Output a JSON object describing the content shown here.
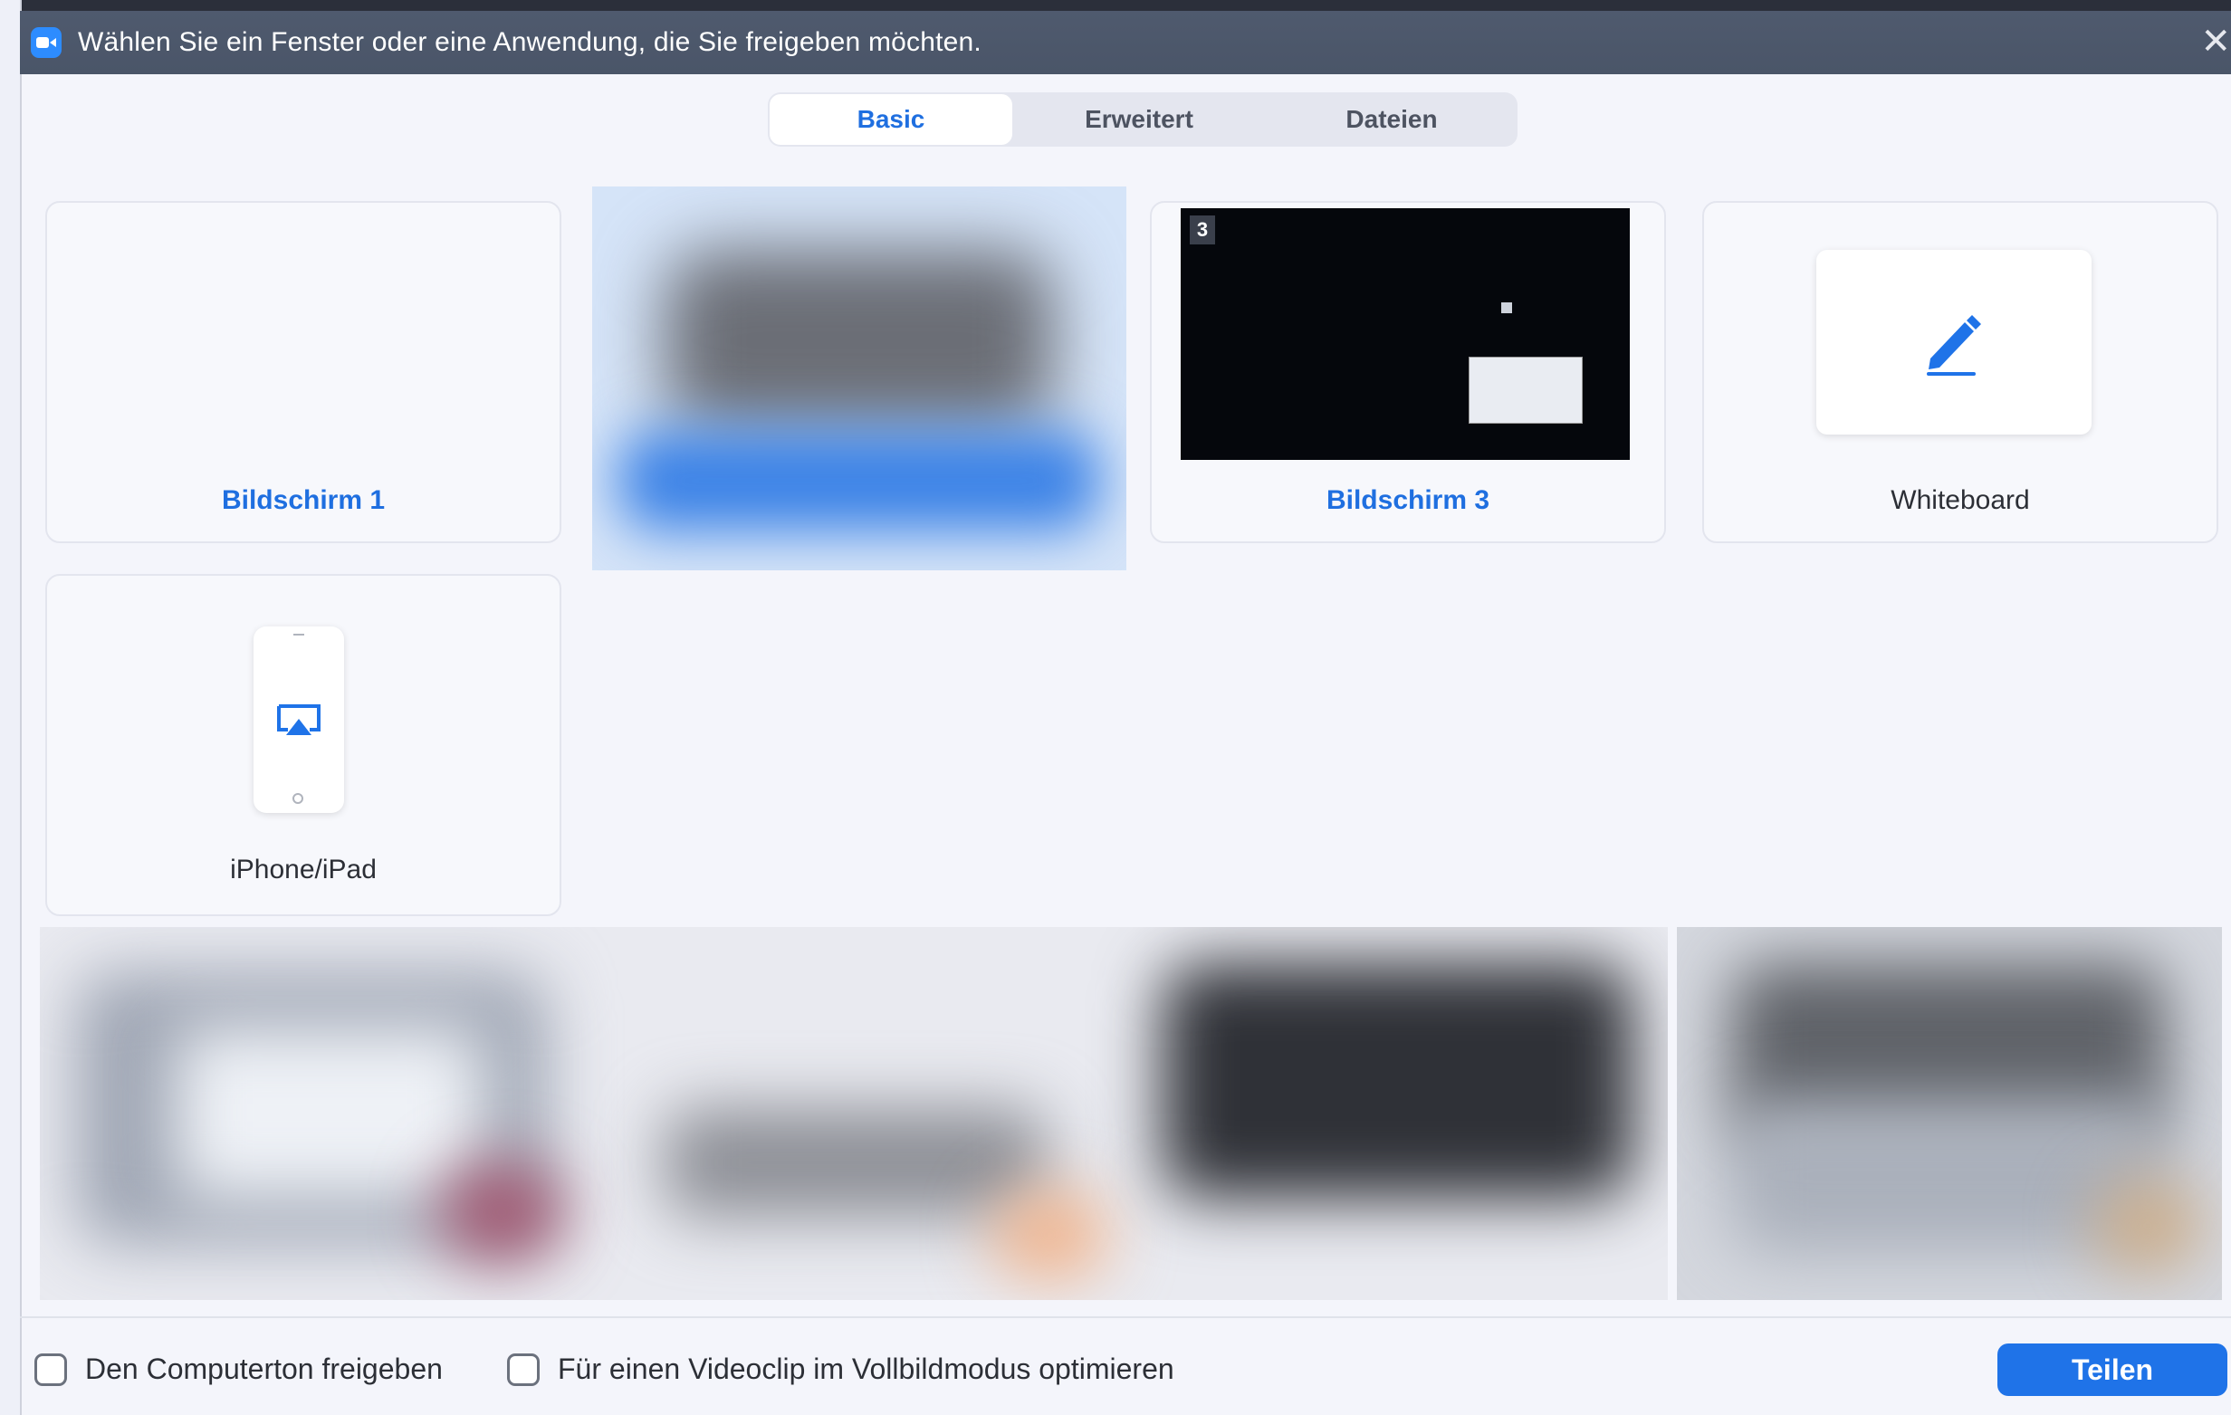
{
  "window": {
    "title": "Wählen Sie ein Fenster oder eine Anwendung, die Sie freigeben möchten."
  },
  "tabs": [
    {
      "label": "Basic",
      "active": true
    },
    {
      "label": "Erweitert",
      "active": false
    },
    {
      "label": "Dateien",
      "active": false
    }
  ],
  "sources": {
    "screen1_label": "Bildschirm 1",
    "screen3_label": "Bildschirm 3",
    "screen3_number": "3",
    "whiteboard_label": "Whiteboard",
    "iphone_label": "iPhone/iPad"
  },
  "footer": {
    "share_audio_label": "Den Computerton freigeben",
    "optimize_video_label": "Für einen Videoclip im Vollbildmodus optimieren",
    "share_button_label": "Teilen"
  },
  "colors": {
    "accent": "#1f73e8",
    "titlebar": "#4f5a6e"
  }
}
